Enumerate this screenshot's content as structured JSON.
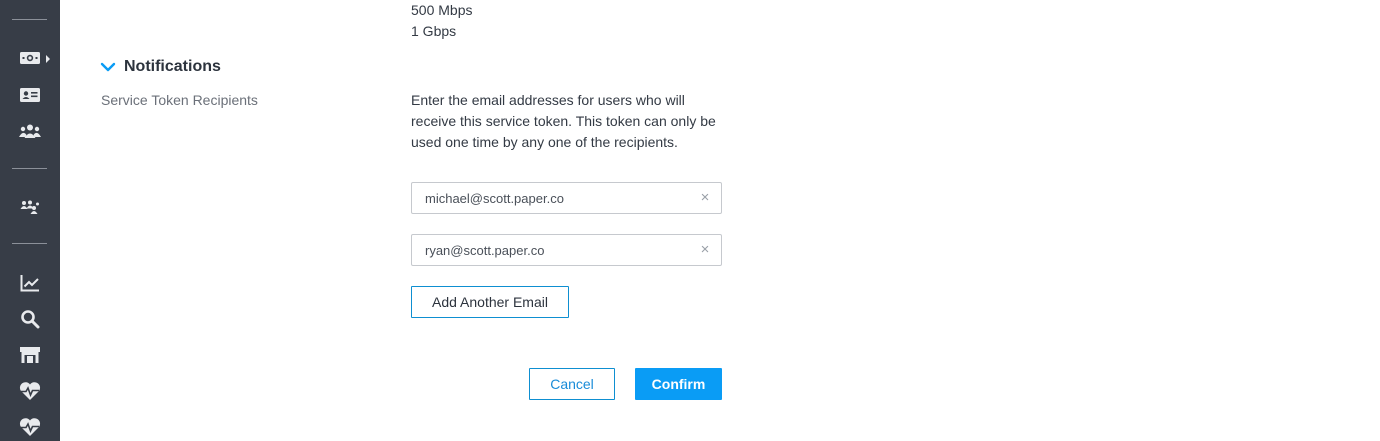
{
  "bandwidth": {
    "options": [
      "500 Mbps",
      "1 Gbps"
    ]
  },
  "notifications": {
    "title": "Notifications",
    "field_label": "Service Token Recipients",
    "help_text": "Enter the email addresses for users who will receive this service token. This token can only be used one time by any one of the recipients.",
    "emails": [
      "michael@scott.paper.co",
      "ryan@scott.paper.co"
    ],
    "clear_glyph": "×",
    "add_email_label": "Add Another Email"
  },
  "actions": {
    "cancel_label": "Cancel",
    "confirm_label": "Confirm"
  },
  "sidebar": {
    "icons": [
      "billing-icon",
      "id-card-icon",
      "users-icon",
      "team-icon",
      "analytics-icon",
      "search-icon",
      "marketplace-icon",
      "health-icon",
      "monitoring-icon"
    ]
  },
  "colors": {
    "sidebar_bg": "#373d47",
    "accent": "#0a9cf5",
    "outline_border": "#0e8fd1"
  }
}
